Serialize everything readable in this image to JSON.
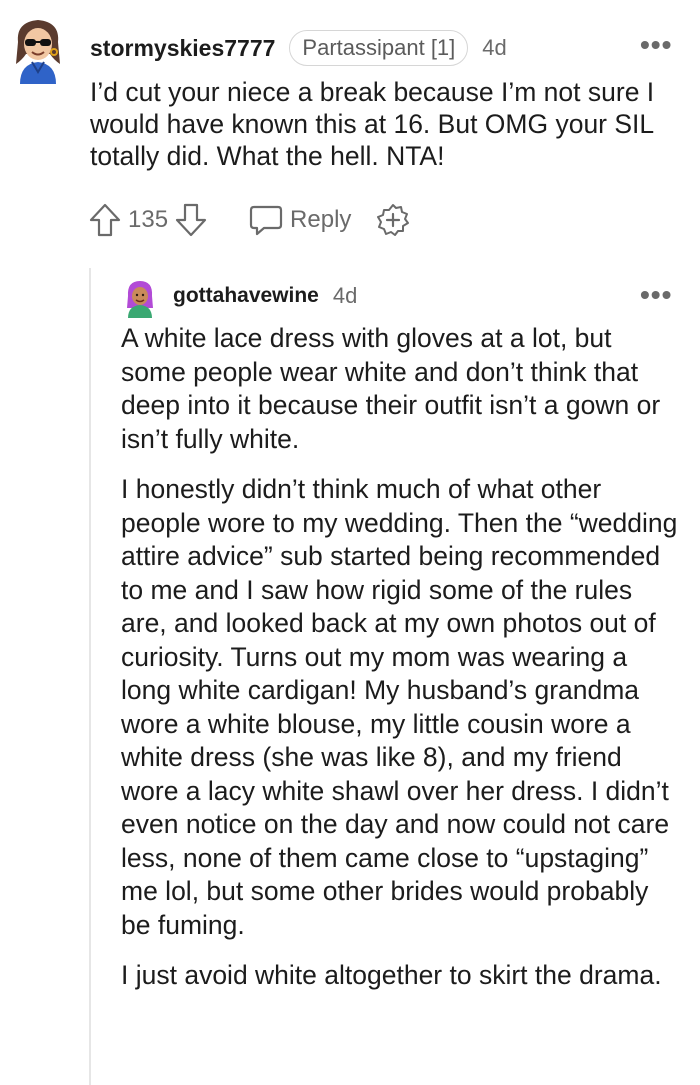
{
  "comment": {
    "username": "stormyskies7777",
    "flair": "Partassipant [1]",
    "time": "4d",
    "more_icon": "more-options-icon",
    "body": "I’d cut your niece a break because I’m not sure I would have known this at 16. But OMG your SIL totally did. What the hell. NTA!",
    "upvote_icon": "upvote-icon",
    "score": "135",
    "downvote_icon": "downvote-icon",
    "reply_icon": "reply-icon",
    "reply_label": "Reply",
    "award_icon": "award-icon"
  },
  "reply": {
    "username": "gottahavewine",
    "time": "4d",
    "more_icon": "more-options-icon",
    "paragraphs": [
      "A white lace dress with gloves at a lot, but some people wear white and don’t think that deep into it because their outfit isn’t a gown or isn’t fully white.",
      "I honestly didn’t think much of what other people wore to my wedding. Then the “wedding attire advice” sub started being recommended to me and I saw how rigid some of the rules are, and looked back at my own photos out of curiosity. Turns out my mom was wearing a long white cardigan! My husband’s grandma wore a white blouse, my little cousin wore a white dress (she was like 8), and my friend wore a lacy white shawl over her dress. I didn’t even notice on the day and now could not care less, none of them came close to “upstaging” me lol, but some other brides would probably be fuming.",
      "I just avoid white altogether to skirt the drama."
    ]
  },
  "colors": {
    "text": "#1c1c1c",
    "muted": "#6a6a6a",
    "thread_line": "#e6e6e6"
  }
}
